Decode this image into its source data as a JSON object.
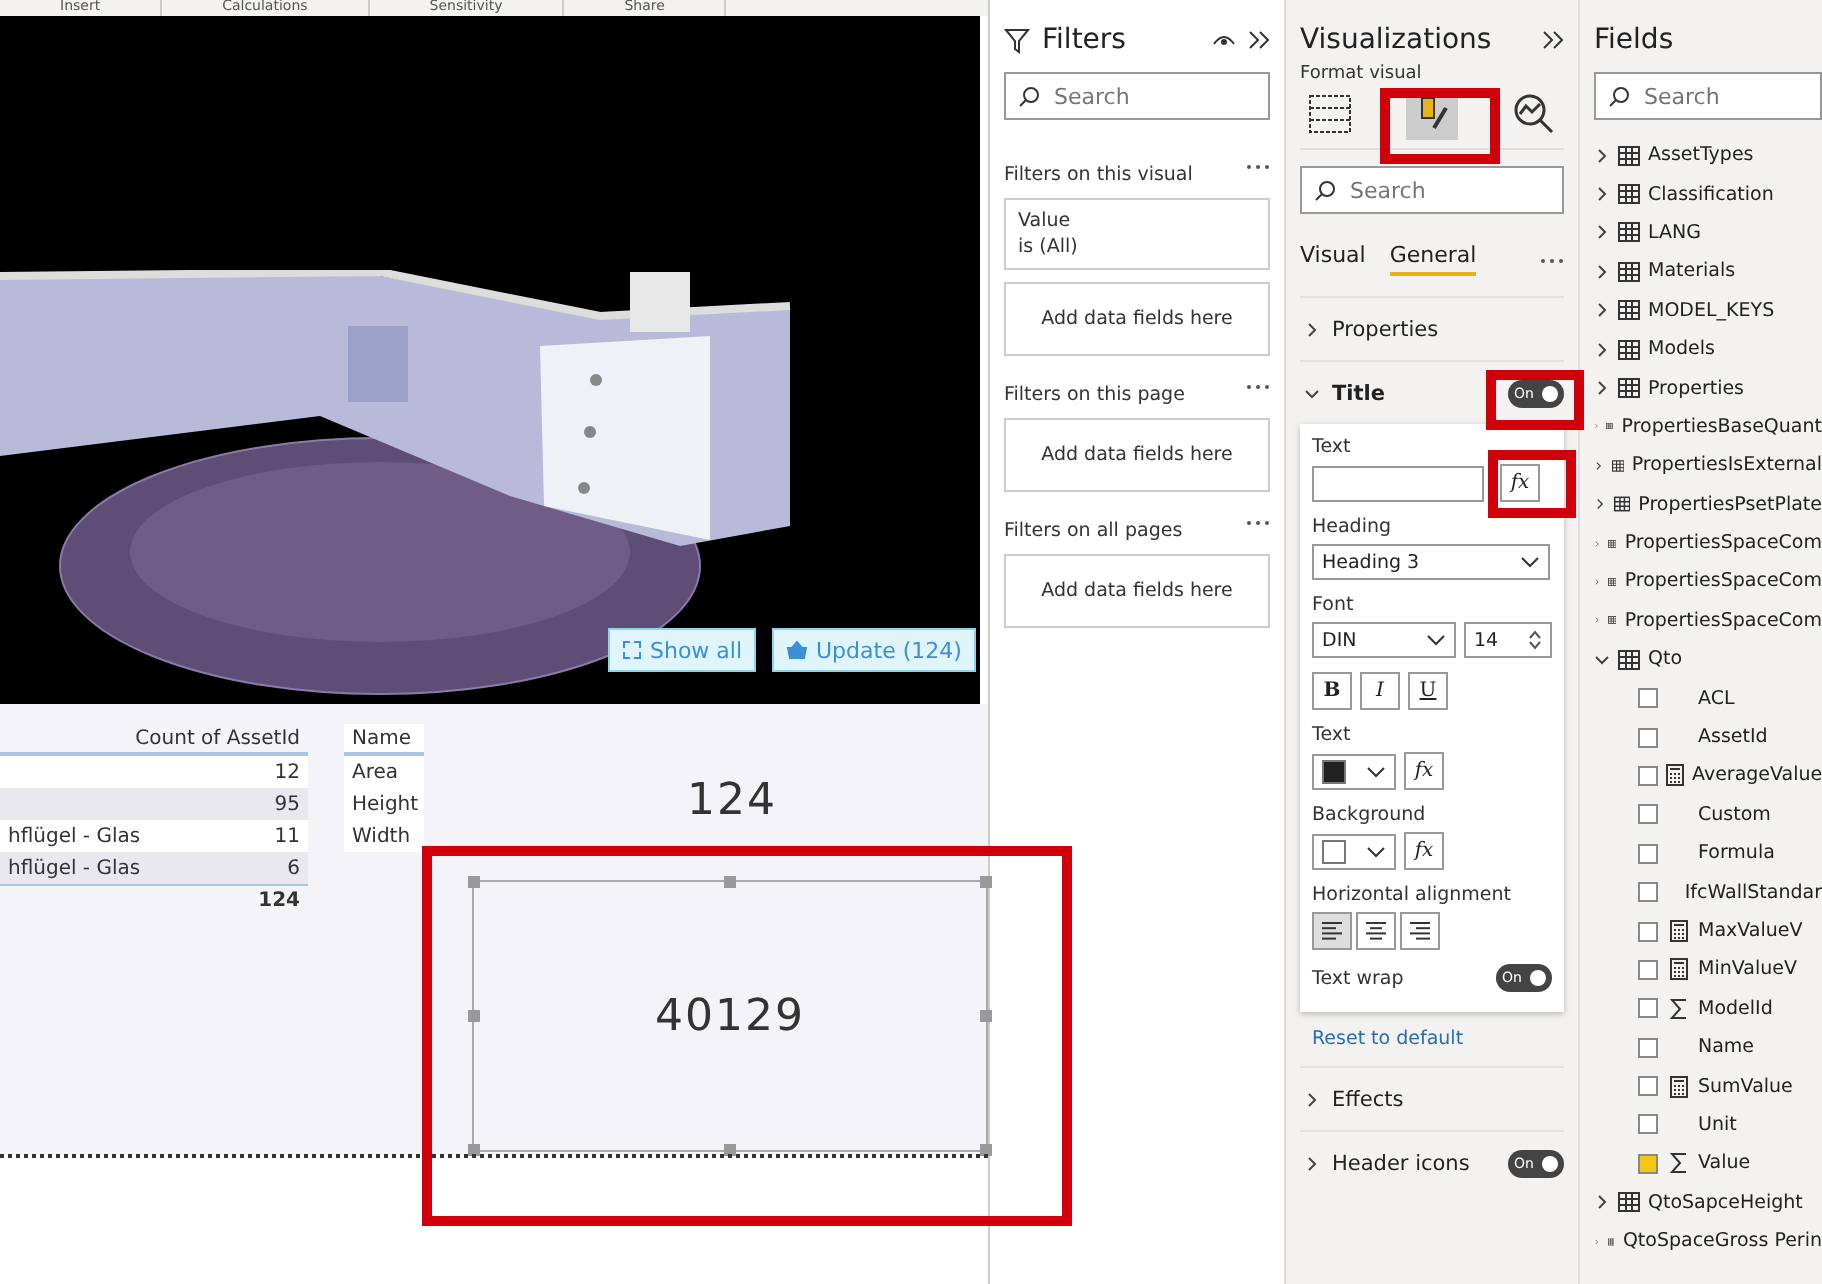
{
  "ribbon": {
    "groups": [
      "Insert",
      "Calculations",
      "Sensitivity",
      "Share"
    ]
  },
  "viewer": {
    "buttons": [
      {
        "kind": "fit",
        "label": "Show all"
      },
      {
        "kind": "update",
        "label": "Update (124)"
      }
    ]
  },
  "table": {
    "columns": [
      "",
      "Count of AssetId"
    ],
    "rows": [
      [
        "",
        "12"
      ],
      [
        "",
        "95"
      ],
      [
        "hflügel - Glas",
        "11"
      ],
      [
        "hflügel - Glas",
        "6"
      ]
    ],
    "total": "124"
  },
  "name_list": {
    "header": "Name",
    "rows": [
      "Area",
      "Height",
      "Width"
    ]
  },
  "cards": [
    {
      "value": "124",
      "selected": false
    },
    {
      "value": "40129",
      "selected": true
    }
  ],
  "filters": {
    "title": "Filters",
    "search": {
      "placeholder": "Search"
    },
    "sections": [
      {
        "title": "Filters on this visual",
        "cards": [
          {
            "field": "Value",
            "condition": "is (All)"
          }
        ],
        "drop": "Add data fields here"
      },
      {
        "title": "Filters on this page",
        "drop": "Add data fields here"
      },
      {
        "title": "Filters on all pages",
        "drop": "Add data fields here"
      }
    ]
  },
  "visualizations": {
    "title": "Visualizations",
    "subtitle": "Format visual",
    "search": {
      "placeholder": "Search"
    },
    "tabs": [
      {
        "label": "Visual",
        "selected": false
      },
      {
        "label": "General",
        "selected": true
      }
    ],
    "sections": [
      {
        "label": "Properties",
        "expanded": false
      },
      {
        "label": "Title",
        "expanded": true,
        "on": true,
        "toggle_label": "On"
      }
    ],
    "title_card": {
      "text_label": "Text",
      "heading_label": "Heading",
      "heading_value": "Heading 3",
      "font_label": "Font",
      "font_value": "DIN",
      "size_value": "14",
      "style_buttons": [
        "B",
        "I",
        "U"
      ],
      "text_color_label": "Text",
      "background_label": "Background",
      "fx_buttons": [
        "fx",
        "fx",
        "fx"
      ],
      "align_label": "Horizontal alignment",
      "alignments": [
        {
          "kind": "left",
          "selected": true
        },
        {
          "kind": "center",
          "selected": false
        },
        {
          "kind": "right",
          "selected": false
        }
      ],
      "wrap_label": "Text wrap",
      "wrap_on": true,
      "wrap_toggle_label": "On"
    },
    "reset": "Reset to default",
    "bottom_sections": [
      {
        "label": "Effects"
      },
      {
        "label": "Header icons",
        "on": true,
        "toggle_label": "On"
      }
    ]
  },
  "fields": {
    "title": "Fields",
    "search": {
      "placeholder": "Search"
    },
    "tables": [
      {
        "name": "AssetTypes",
        "expanded": false
      },
      {
        "name": "Classification",
        "expanded": false
      },
      {
        "name": "LANG",
        "expanded": false
      },
      {
        "name": "Materials",
        "expanded": false
      },
      {
        "name": "MODEL_KEYS",
        "expanded": false
      },
      {
        "name": "Models",
        "expanded": false
      },
      {
        "name": "Properties",
        "expanded": false
      },
      {
        "name": "PropertiesBaseQuant",
        "expanded": false
      },
      {
        "name": "PropertiesIsExternal",
        "expanded": false
      },
      {
        "name": "PropertiesPsetPlate",
        "expanded": false
      },
      {
        "name": "PropertiesSpaceCom",
        "expanded": false
      },
      {
        "name": "PropertiesSpaceCom",
        "expanded": false
      },
      {
        "name": "PropertiesSpaceCom",
        "expanded": false
      },
      {
        "name": "Qto",
        "expanded": true,
        "children": [
          {
            "name": "ACL",
            "kind": "plain",
            "checked": false
          },
          {
            "name": "AssetId",
            "kind": "plain",
            "checked": false
          },
          {
            "name": "AverageValue",
            "kind": "calc",
            "checked": false
          },
          {
            "name": "Custom",
            "kind": "plain",
            "checked": false
          },
          {
            "name": "Formula",
            "kind": "plain",
            "checked": false
          },
          {
            "name": "IfcWallStandar",
            "kind": "plain",
            "checked": false
          },
          {
            "name": "MaxValueV",
            "kind": "calc",
            "checked": false
          },
          {
            "name": "MinValueV",
            "kind": "calc",
            "checked": false
          },
          {
            "name": "ModelId",
            "kind": "sum",
            "checked": false
          },
          {
            "name": "Name",
            "kind": "plain",
            "checked": false
          },
          {
            "name": "SumValue",
            "kind": "calc",
            "checked": false
          },
          {
            "name": "Unit",
            "kind": "plain",
            "checked": false
          },
          {
            "name": "Value",
            "kind": "sum",
            "checked": true
          }
        ]
      },
      {
        "name": "QtoSapceHeight",
        "expanded": false
      },
      {
        "name": "QtoSpaceGross Perin",
        "expanded": false
      }
    ]
  }
}
